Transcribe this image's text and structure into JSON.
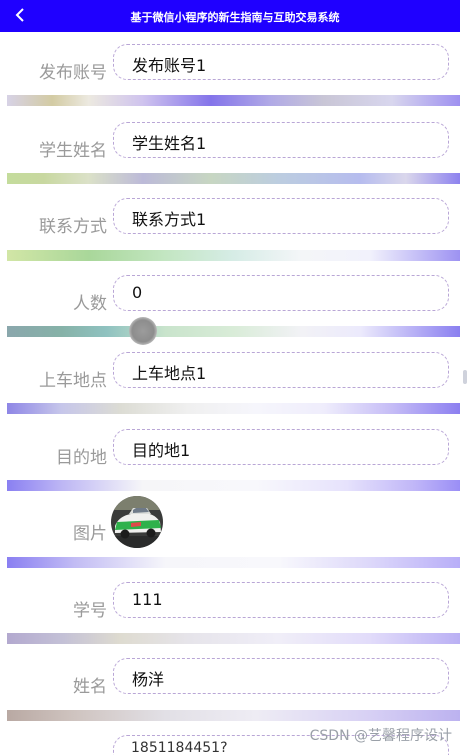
{
  "header": {
    "title": "基于微信小程序的新生指南与互助交易系统",
    "back_icon": "chevron-left-icon",
    "background_color": "#1f00ff"
  },
  "form": {
    "fields": [
      {
        "label": "发布账号",
        "value": "发布账号1"
      },
      {
        "label": "学生姓名",
        "value": "学生姓名1"
      },
      {
        "label": "联系方式",
        "value": "联系方式1"
      },
      {
        "label": "人数",
        "value": "0"
      },
      {
        "label": "上车地点",
        "value": "上车地点1"
      },
      {
        "label": "目的地",
        "value": "目的地1"
      },
      {
        "label": "图片",
        "image": "car-photo"
      },
      {
        "label": "学号",
        "value": "111"
      },
      {
        "label": "姓名",
        "value": "杨洋"
      }
    ],
    "partial_next_value": "1851184451?"
  },
  "watermark": "CSDN @艺馨程序设计"
}
